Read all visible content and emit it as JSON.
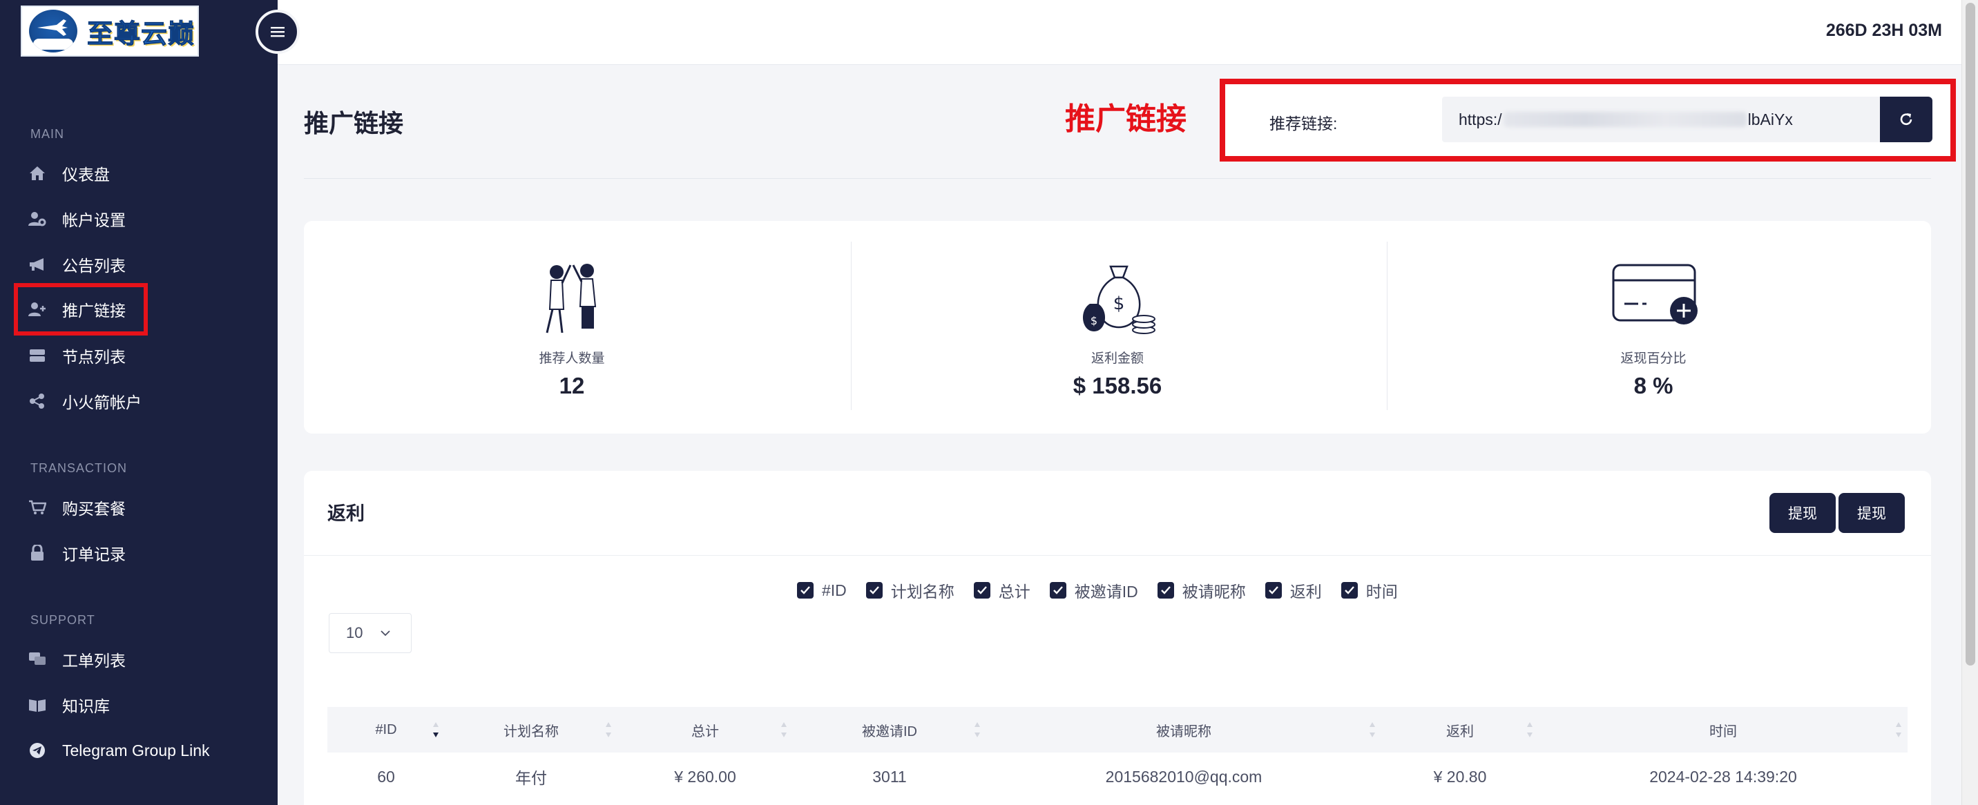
{
  "brand": {
    "logo_text": "至尊云巅"
  },
  "topbar": {
    "timer": "266D 23H 03M"
  },
  "sidebar": {
    "sections": {
      "main": "MAIN",
      "transaction": "TRANSACTION",
      "support": "SUPPORT"
    },
    "items": [
      {
        "label": "仪表盘",
        "icon": "home-icon"
      },
      {
        "label": "帐户设置",
        "icon": "user-gear-icon"
      },
      {
        "label": "公告列表",
        "icon": "megaphone-icon"
      },
      {
        "label": "推广链接",
        "icon": "user-plus-icon"
      },
      {
        "label": "节点列表",
        "icon": "server-icon"
      },
      {
        "label": "小火箭帐户",
        "icon": "share-nodes-icon"
      },
      {
        "label": "购买套餐",
        "icon": "cart-icon"
      },
      {
        "label": "订单记录",
        "icon": "lock-icon"
      },
      {
        "label": "工单列表",
        "icon": "chat-icon"
      },
      {
        "label": "知识库",
        "icon": "book-icon"
      },
      {
        "label": "Telegram Group Link",
        "icon": "telegram-icon"
      }
    ]
  },
  "header": {
    "title": "推广链接",
    "annotation": "推广链接",
    "ref_label": "推荐链接:",
    "ref_url_start": "https:/",
    "ref_url_end": "lbAiYx"
  },
  "stats": [
    {
      "label": "推荐人数量",
      "value": "12",
      "icon": "high-five-illustration"
    },
    {
      "label": "返利金额",
      "value": "$ 158.56",
      "icon": "money-bag-illustration"
    },
    {
      "label": "返现百分比",
      "value": "8 %",
      "icon": "credit-card-plus-illustration"
    }
  ],
  "rebate": {
    "title": "返利",
    "buttons": [
      "提现",
      "提现"
    ],
    "column_toggles": [
      "#ID",
      "计划名称",
      "总计",
      "被邀请ID",
      "被请昵称",
      "返利",
      "时间"
    ],
    "page_size": "10",
    "columns": [
      "#ID",
      "计划名称",
      "总计",
      "被邀请ID",
      "被请昵称",
      "返利",
      "时间"
    ],
    "rows": [
      {
        "id": "60",
        "plan": "年付",
        "total": "¥ 260.00",
        "invitee_id": "3011",
        "nickname": "2015682010@qq.com",
        "rebate": "¥ 20.80",
        "time": "2024-02-28 14:39:20"
      }
    ]
  },
  "colors": {
    "sidebar_bg": "#1b2140",
    "accent_red": "#e6121a",
    "page_bg": "#f4f5f8"
  }
}
